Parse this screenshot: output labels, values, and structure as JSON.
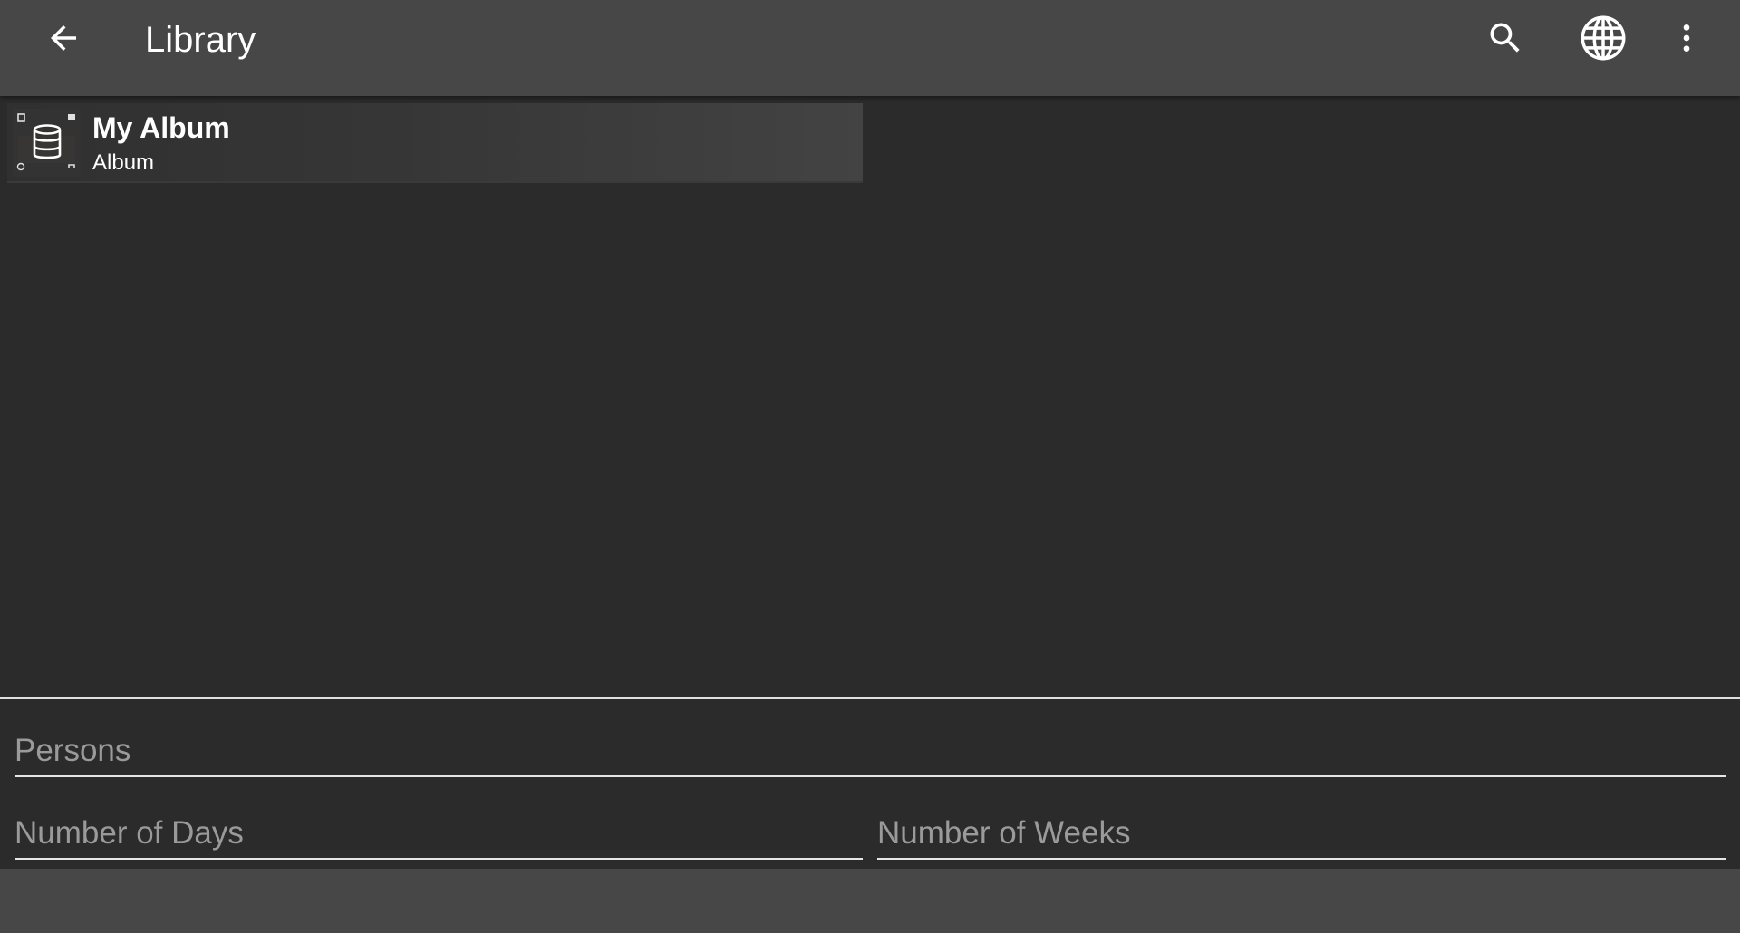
{
  "app_bar": {
    "title": "Library",
    "icons": [
      "arrow-back-icon",
      "search-icon",
      "globe-icon",
      "more-vert-icon"
    ]
  },
  "library": {
    "items": [
      {
        "title": "My Album",
        "subtitle": "Album",
        "thumbnail_icon": "database-icon"
      }
    ]
  },
  "form": {
    "persons_placeholder": "Persons",
    "days_placeholder": "Number of Days",
    "weeks_placeholder": "Number of Weeks",
    "persons_value": "",
    "days_value": "",
    "weeks_value": ""
  },
  "colors": {
    "app_bar": "#474747",
    "background": "#2b2b2b",
    "text": "#ffffff",
    "placeholder": "#9a9a9a",
    "underline": "#e6e6e6"
  }
}
